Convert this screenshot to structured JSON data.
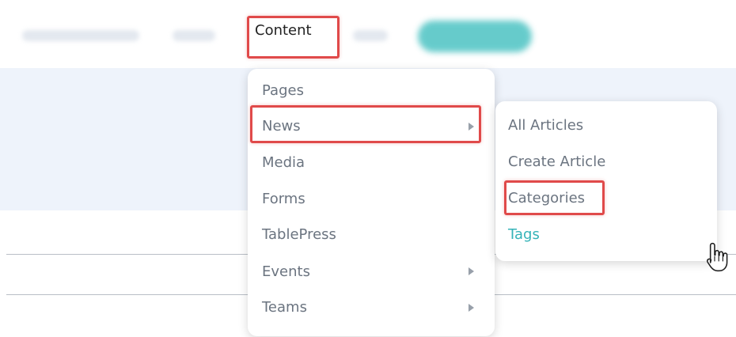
{
  "nav": {
    "content_label": "Content"
  },
  "content_menu": {
    "items": [
      {
        "label": "Pages",
        "has_submenu": false
      },
      {
        "label": "News",
        "has_submenu": true
      },
      {
        "label": "Media",
        "has_submenu": false
      },
      {
        "label": "Forms",
        "has_submenu": false
      },
      {
        "label": "TablePress",
        "has_submenu": false
      },
      {
        "label": "Events",
        "has_submenu": true
      },
      {
        "label": "Teams",
        "has_submenu": true
      }
    ]
  },
  "news_submenu": {
    "items": [
      {
        "label": "All Articles"
      },
      {
        "label": "Create Article"
      },
      {
        "label": "Categories"
      },
      {
        "label": "Tags"
      }
    ]
  },
  "colors": {
    "highlight": "#e04a4a",
    "accent_teal": "#34b3b8",
    "menu_text": "#6b7480"
  },
  "icons": {
    "submenu_arrow": "chevron-right-icon",
    "cursor": "hand-pointer-icon"
  }
}
